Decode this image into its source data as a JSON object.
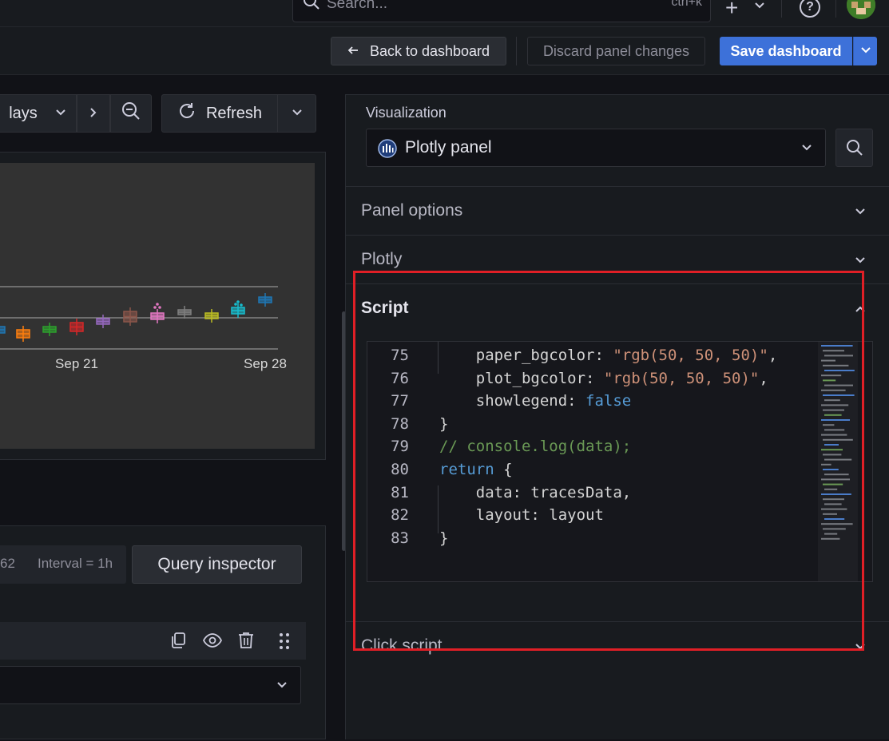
{
  "topbar": {
    "search_placeholder": "Search...",
    "search_shortcut": "ctrl+k",
    "plus_label": "+",
    "help_label": "?"
  },
  "toolbar": {
    "back_label": "Back to dashboard",
    "discard_label": "Discard panel changes",
    "save_label": "Save dashboard"
  },
  "time_controls": {
    "range_label": "lays",
    "refresh_label": "Refresh"
  },
  "chart_data": {
    "type": "box",
    "x_tick_labels": [
      "Sep 21",
      "Sep 28"
    ],
    "series_colors": [
      "#1f77b4",
      "#ff7f0e",
      "#2ca02c",
      "#d62728",
      "#9467bd",
      "#8c564b",
      "#e377c2",
      "#7f7f7f",
      "#bcbd22",
      "#17becf",
      "#1f77b4"
    ],
    "background": "#323232",
    "showlegend": false
  },
  "query": {
    "count_fragment": "62",
    "interval_label": "Interval = 1h",
    "inspector_label": "Query inspector"
  },
  "right_pane": {
    "visualization_label": "Visualization",
    "plugin_name": "Plotly panel",
    "sections": [
      "Panel options",
      "Plotly",
      "Script",
      "Click script"
    ]
  },
  "editor": {
    "lines": [
      {
        "num": "75",
        "tokens": [
          [
            "    paper_bgcolor: ",
            "p"
          ],
          [
            "\"rgb(50, 50, 50)\"",
            "str"
          ],
          [
            ",",
            "p"
          ]
        ]
      },
      {
        "num": "76",
        "tokens": [
          [
            "    plot_bgcolor: ",
            "p"
          ],
          [
            "\"rgb(50, 50, 50)\"",
            "str"
          ],
          [
            ",",
            "p"
          ]
        ]
      },
      {
        "num": "77",
        "tokens": [
          [
            "    showlegend: ",
            "p"
          ],
          [
            "false",
            "kw"
          ]
        ]
      },
      {
        "num": "78",
        "tokens": [
          [
            "}",
            "p"
          ]
        ]
      },
      {
        "num": "79",
        "tokens": [
          [
            "// console.log(data);",
            "cm"
          ]
        ]
      },
      {
        "num": "80",
        "tokens": [
          [
            "return",
            "kw"
          ],
          [
            " {",
            "p"
          ]
        ]
      },
      {
        "num": "81",
        "tokens": [
          [
            "    data: tracesData,",
            "p"
          ]
        ]
      },
      {
        "num": "82",
        "tokens": [
          [
            "    layout: layout",
            "p"
          ]
        ]
      },
      {
        "num": "83",
        "tokens": [
          [
            "}",
            "p"
          ]
        ]
      }
    ]
  }
}
